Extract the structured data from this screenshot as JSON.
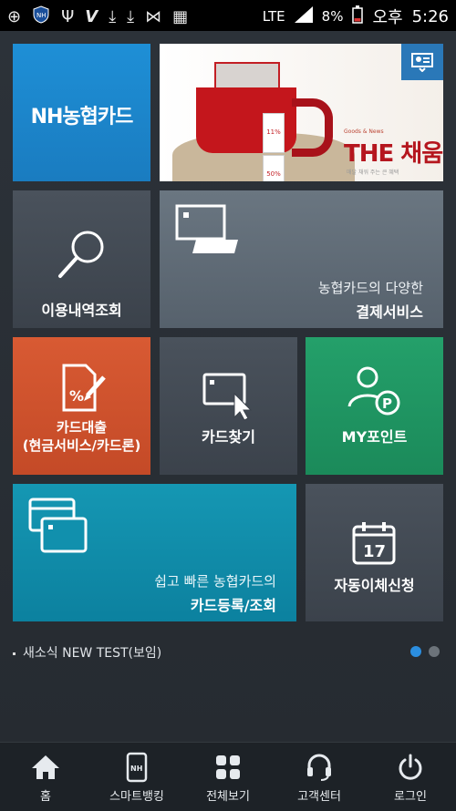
{
  "status_bar": {
    "network": "LTE",
    "battery": "8%",
    "time_prefix": "오후",
    "time": "5:26"
  },
  "tiles": {
    "nh_logo": "NH농협카드",
    "banner": {
      "mini": "Goods & News",
      "title": "THE 채움",
      "subtitle": "매달 채워 주는 큰 혜택",
      "tag_percent1": "11%",
      "tag_percent2": "50%"
    },
    "usage": {
      "label": "이용내역조회"
    },
    "payment": {
      "line1": "농협카드의 다양한",
      "line2": "결제서비스"
    },
    "loan": {
      "line1": "카드대출",
      "line2": "(현금서비스/카드론)"
    },
    "find": {
      "label": "카드찾기"
    },
    "point": {
      "label": "MY포인트"
    },
    "register": {
      "line1": "쉽고 빠른 농협카드의",
      "line2": "카드등록/조회"
    },
    "auto_transfer": {
      "label": "자동이체신청",
      "calendar_day": "17"
    }
  },
  "news": {
    "text": "새소식 NEW TEST(보임)"
  },
  "pager": {
    "active_index": 0,
    "count": 2
  },
  "bottom_nav": {
    "items": [
      {
        "label": "홈",
        "icon": "home-icon"
      },
      {
        "label": "스마트뱅킹",
        "icon": "smart-banking-icon"
      },
      {
        "label": "전체보기",
        "icon": "grid-icon"
      },
      {
        "label": "고객센터",
        "icon": "headset-icon"
      },
      {
        "label": "로그인",
        "icon": "power-icon"
      }
    ]
  },
  "colors": {
    "nh_blue": "#1a84c9",
    "loan_orange": "#cf5230",
    "point_green": "#1f9563",
    "register_teal": "#1190ad",
    "page_bg": "#262b31",
    "pager_active": "#2b8ee0"
  }
}
